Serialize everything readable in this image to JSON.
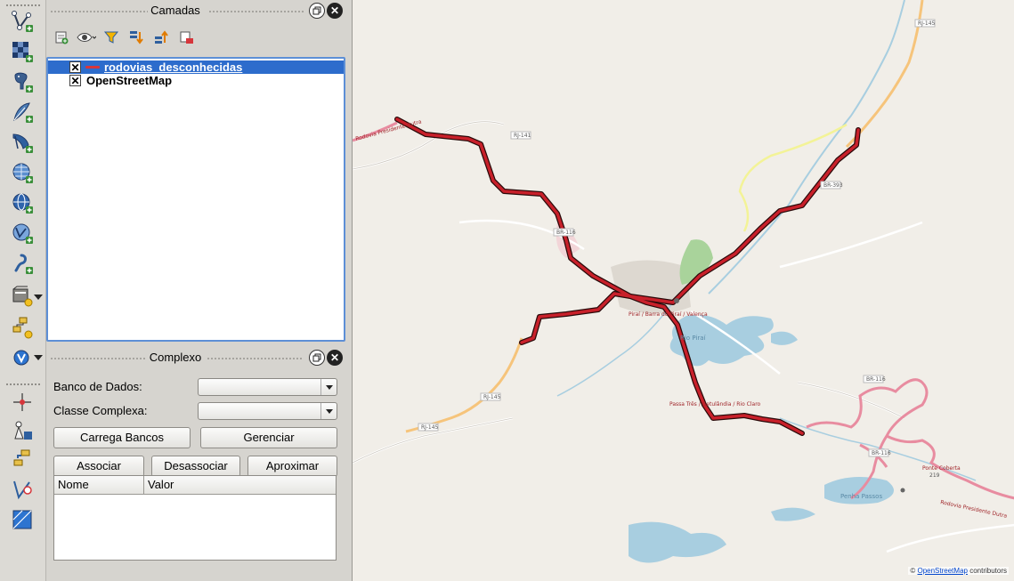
{
  "layers_panel": {
    "title": "Camadas",
    "toolbar_icons": [
      "add-group-icon",
      "visibility-icon",
      "filter-icon",
      "expand-all-icon",
      "collapse-all-icon",
      "remove-layer-icon"
    ],
    "layers": [
      {
        "name": "rodovias_desconhecidas",
        "checked": true,
        "selected": true,
        "symbol_color": "#d6363b"
      },
      {
        "name": "OpenStreetMap",
        "checked": true,
        "selected": false
      }
    ]
  },
  "complexo_panel": {
    "title": "Complexo",
    "banco_label": "Banco de Dados:",
    "banco_value": "",
    "classe_label": "Classe Complexa:",
    "classe_value": "",
    "buttons": {
      "carrega": "Carrega Bancos",
      "gerenciar": "Gerenciar",
      "associar": "Associar",
      "desassociar": "Desassociar",
      "aproximar": "Aproximar"
    },
    "table_headers": [
      "Nome",
      "Valor"
    ]
  },
  "map": {
    "labels": [
      "RJ-145",
      "RJ-141",
      "BR-116",
      "RJ-145",
      "RJ-145",
      "BR-116",
      "BR-116",
      "BR-393",
      "Piraí / Barra do Piraí / Valença",
      "Passa Três / Getulândia / Rio Claro",
      "Ponte Coberta",
      "219",
      "Rio Piraí",
      "Penha Passos",
      "Rodovia Presidente Dutra",
      "Rodovia Presidente Dutra"
    ],
    "attribution_prefix": "©",
    "attribution_link": "OpenStreetMap",
    "attribution_suffix": "contributors",
    "highlight_color": "#c8202a"
  }
}
